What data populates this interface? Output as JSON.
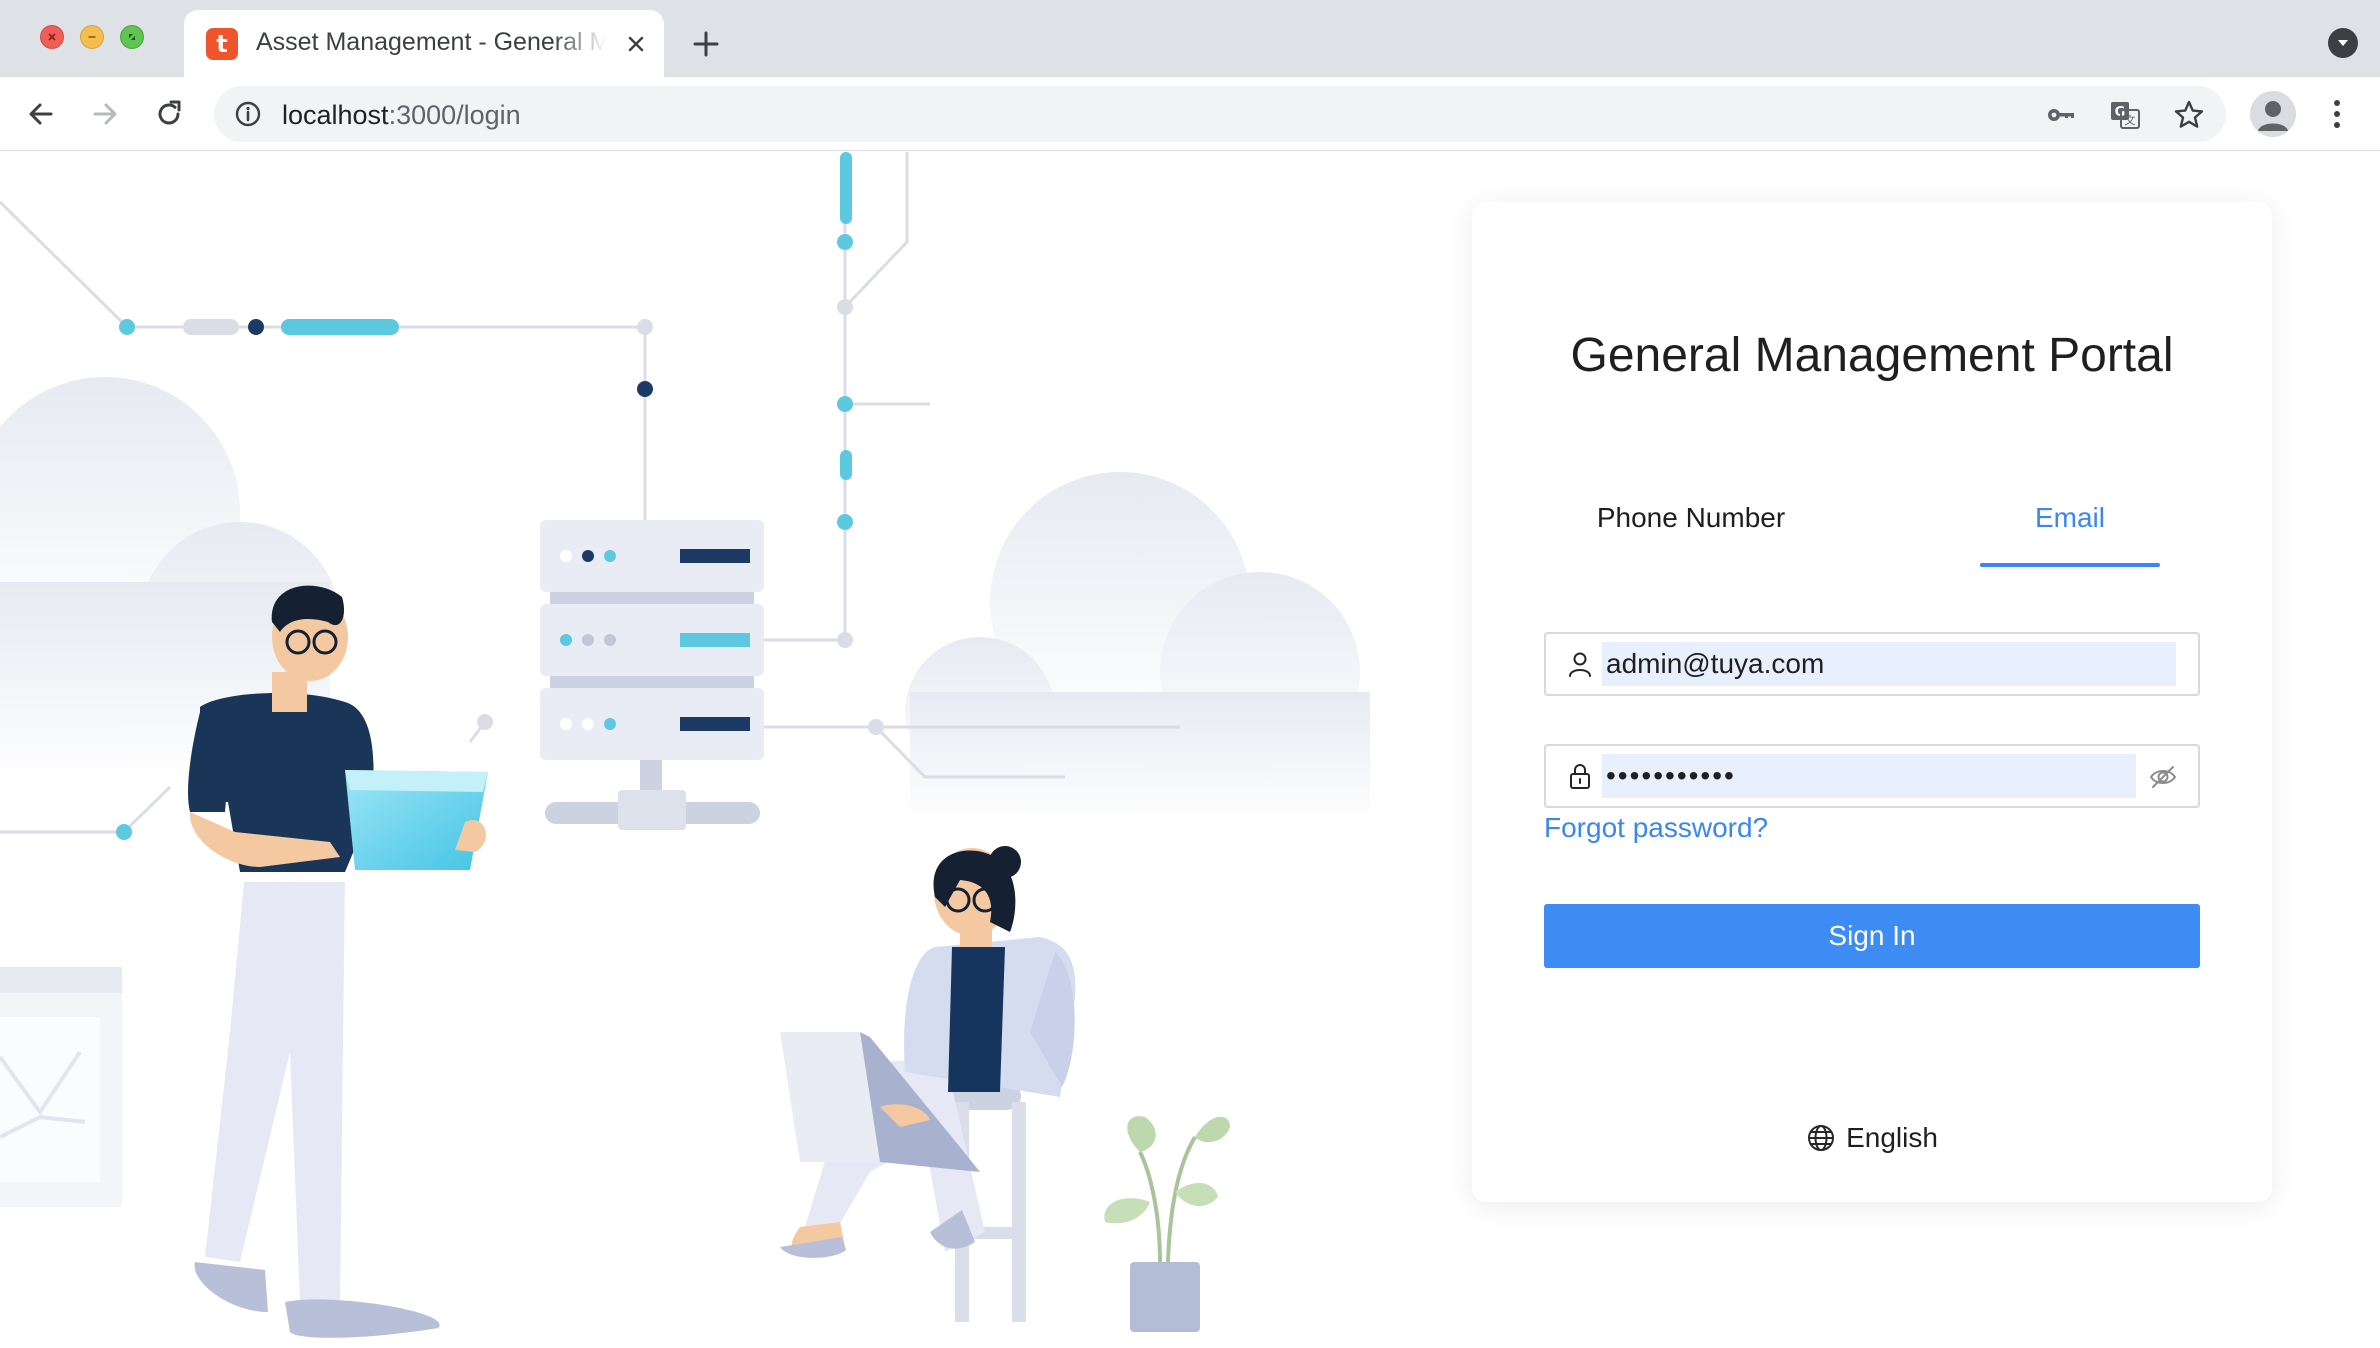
{
  "browser": {
    "tab_title": "Asset Management - General Management Portal",
    "tab_favicon_letter": "t",
    "url_host": "localhost",
    "url_path": ":3000/login"
  },
  "login": {
    "title": "General Management Portal",
    "tabs": [
      {
        "label": "Phone Number",
        "active": false
      },
      {
        "label": "Email",
        "active": true
      }
    ],
    "email_value": "admin@tuya.com",
    "password_masked": "•••••••••••",
    "forgot_label": "Forgot password?",
    "signin_label": "Sign In",
    "language": "English"
  },
  "colors": {
    "accent": "#3a87ef",
    "button": "#3e8bf3",
    "autofill_bg": "#e8f0fe",
    "illustration_cyan": "#5cc9e0",
    "illustration_navy": "#1c3a63"
  }
}
